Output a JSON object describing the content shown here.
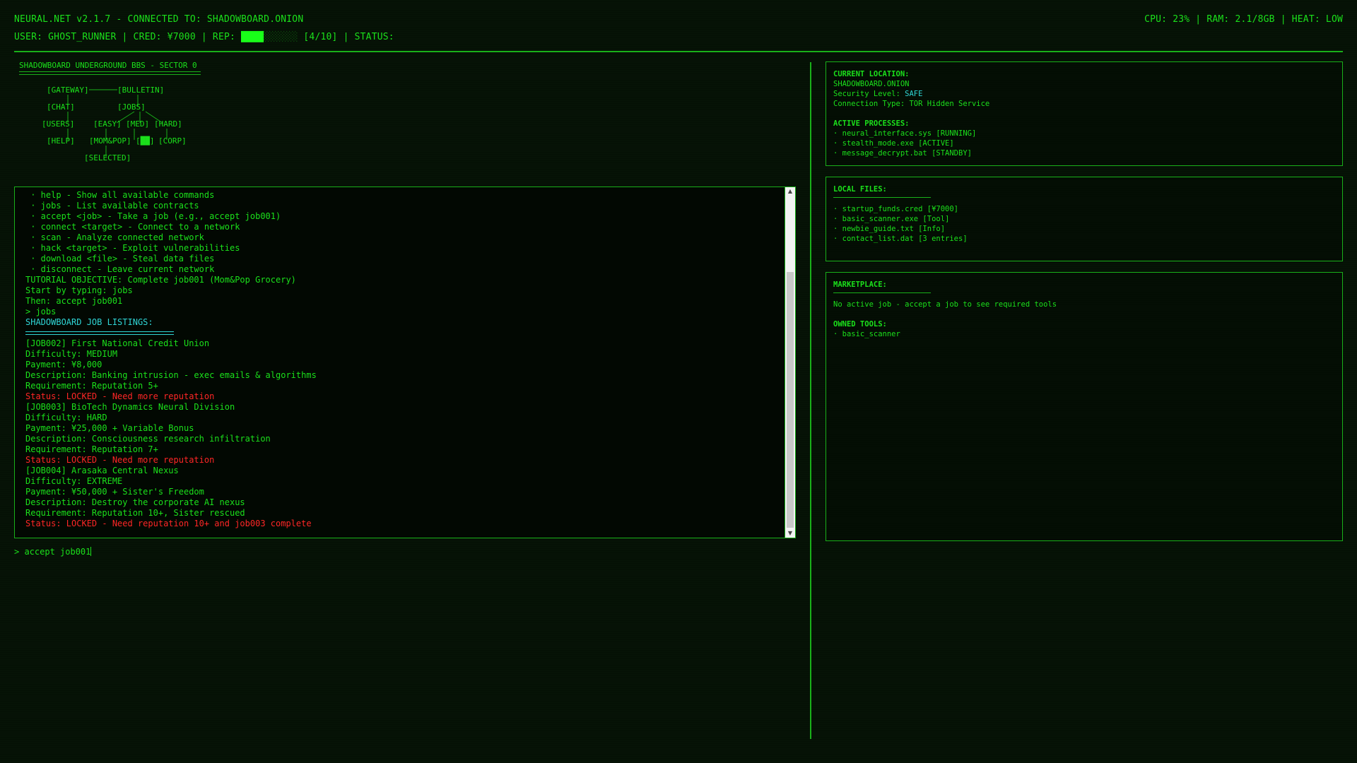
{
  "header": {
    "title": "NEURAL.NET v2.1.7 - CONNECTED TO: SHADOWBOARD.ONION",
    "user_line": "USER: GHOST_RUNNER | CRED: ¥7000 | REP: ",
    "rep_filled": "████",
    "rep_empty": "░░░░░░",
    "rep_suffix": " [4/10] | STATUS:",
    "system": "CPU: 23% | RAM: 2.1/8GB | HEAT: LOW"
  },
  "bbs": {
    "title": "SHADOWBOARD UNDERGROUND BBS - SECTOR 0",
    "map": {
      "gateway": "[GATEWAY]",
      "bulletin": "[BULLETIN]",
      "chat": "[CHAT]",
      "jobs": "[JOBS]",
      "users": "[USERS]",
      "easy": "[EASY]",
      "med": "[MED]",
      "hard": "[HARD]",
      "help": "[HELP]",
      "mompop": "[MOM&POP]",
      "sel_open": "[",
      "sel_block": "██",
      "sel_close": "]",
      "corp": "[CORP]",
      "selected": "[SELECTED]"
    }
  },
  "terminal": {
    "lines": [
      {
        "text": " · help - Show all available commands",
        "style": "normal"
      },
      {
        "text": " · jobs - List available contracts",
        "style": "normal"
      },
      {
        "text": " · accept <job> - Take a job (e.g., accept job001)",
        "style": "normal"
      },
      {
        "text": " · connect <target> - Connect to a network",
        "style": "normal"
      },
      {
        "text": " · scan - Analyze connected network",
        "style": "normal"
      },
      {
        "text": " · hack <target> - Exploit vulnerabilities",
        "style": "normal"
      },
      {
        "text": " · download <file> - Steal data files",
        "style": "normal"
      },
      {
        "text": " · disconnect - Leave current network",
        "style": "normal"
      },
      {
        "text": "TUTORIAL OBJECTIVE: Complete job001 (Mom&Pop Grocery)",
        "style": "normal"
      },
      {
        "text": "Start by typing: jobs",
        "style": "normal"
      },
      {
        "text": "Then: accept job001",
        "style": "normal"
      },
      {
        "text": "> jobs",
        "style": "normal"
      },
      {
        "text": "SHADOWBOARD JOB LISTINGS:",
        "style": "cyan"
      },
      {
        "text": "",
        "style": "rule"
      },
      {
        "text": "[JOB002] First National Credit Union",
        "style": "normal"
      },
      {
        "text": "Difficulty: MEDIUM",
        "style": "normal"
      },
      {
        "text": "Payment: ¥8,000",
        "style": "normal"
      },
      {
        "text": "Description: Banking intrusion - exec emails & algorithms",
        "style": "normal"
      },
      {
        "text": "Requirement: Reputation 5+",
        "style": "normal"
      },
      {
        "text": "Status: LOCKED - Need more reputation",
        "style": "red"
      },
      {
        "text": "[JOB003] BioTech Dynamics Neural Division",
        "style": "normal"
      },
      {
        "text": "Difficulty: HARD",
        "style": "normal"
      },
      {
        "text": "Payment: ¥25,000 + Variable Bonus",
        "style": "normal"
      },
      {
        "text": "Description: Consciousness research infiltration",
        "style": "normal"
      },
      {
        "text": "Requirement: Reputation 7+",
        "style": "normal"
      },
      {
        "text": "Status: LOCKED - Need more reputation",
        "style": "red"
      },
      {
        "text": "[JOB004] Arasaka Central Nexus",
        "style": "normal"
      },
      {
        "text": "Difficulty: EXTREME",
        "style": "normal"
      },
      {
        "text": "Payment: ¥50,000 + Sister's Freedom",
        "style": "normal"
      },
      {
        "text": "Description: Destroy the corporate AI nexus",
        "style": "normal"
      },
      {
        "text": "Requirement: Reputation 10+, Sister rescued",
        "style": "normal"
      },
      {
        "text": "Status: LOCKED - Need reputation 10+ and job003 complete",
        "style": "red"
      }
    ],
    "scroll_up": "▲",
    "scroll_down": "▼"
  },
  "command": {
    "prompt": "> ",
    "value": "accept job001"
  },
  "location_panel": {
    "heading": "CURRENT LOCATION:",
    "host": "SHADOWBOARD.ONION",
    "security_label": "Security Level: ",
    "security_value": "SAFE",
    "connection": "Connection Type: TOR Hidden Service",
    "processes_heading": "ACTIVE PROCESSES:",
    "processes": [
      "· neural_interface.sys [RUNNING]",
      "· stealth_mode.exe [ACTIVE]",
      "· message_decrypt.bat [STANDBY]"
    ]
  },
  "files_panel": {
    "heading": "LOCAL FILES:",
    "files": [
      "· startup_funds.cred [¥7000]",
      "· basic_scanner.exe [Tool]",
      "· newbie_guide.txt [Info]",
      "· contact_list.dat [3 entries]"
    ]
  },
  "market_panel": {
    "heading": "MARKETPLACE:",
    "message": "No active job - accept a job to see required tools",
    "tools_heading": "OWNED TOOLS:",
    "tools": [
      "· basic_scanner"
    ]
  },
  "colors": {
    "text": "#1be01b",
    "accent_cyan": "#2fd6d6",
    "alert_red": "#ff2626",
    "background": "#061306"
  }
}
